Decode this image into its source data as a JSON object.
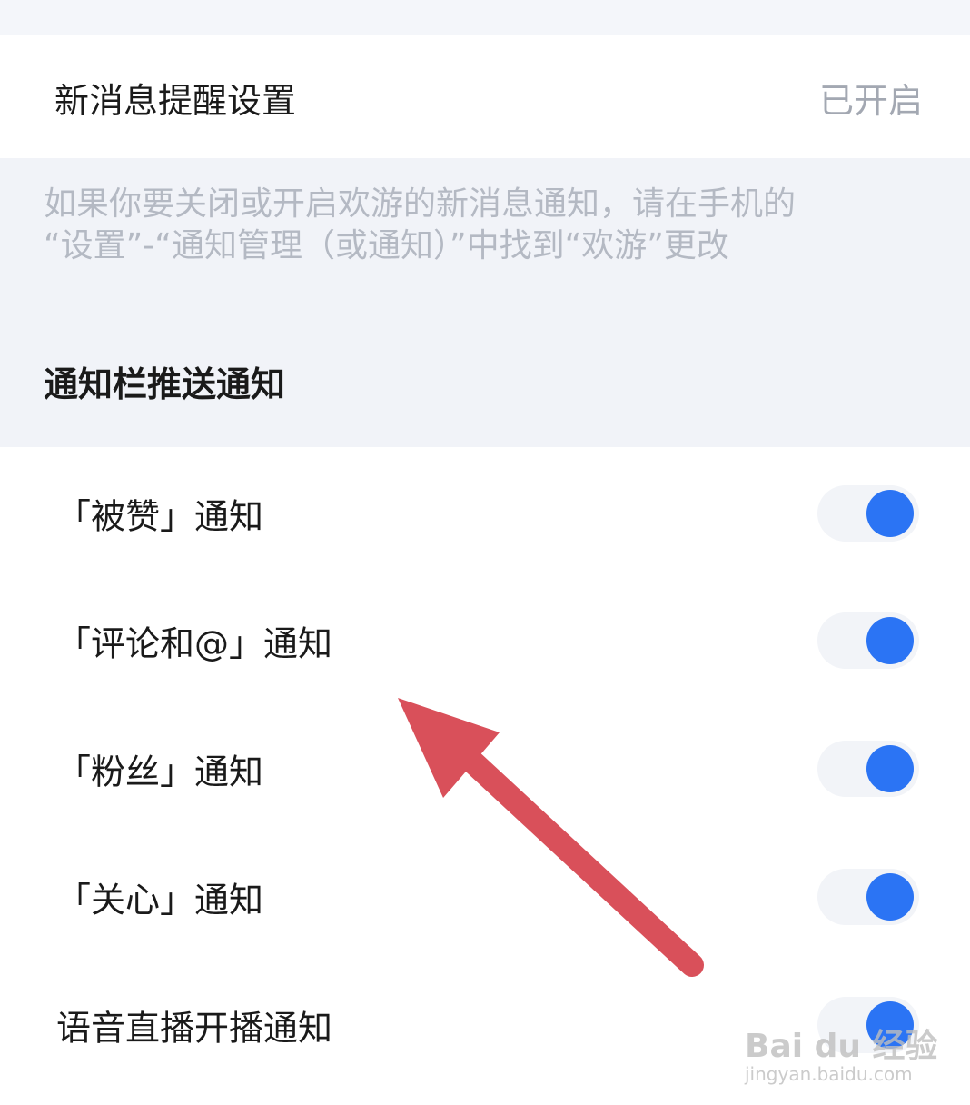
{
  "new_message": {
    "title": "新消息提醒设置",
    "status": "已开启"
  },
  "hint": {
    "line1": "如果你要关闭或开启欢游的新消息通知，请在手机的",
    "line2": "“设置”-“通知管理（或通知）”中找到“欢游”更改"
  },
  "section_title": "通知栏推送通知",
  "items": [
    {
      "label": "「被赞」通知",
      "enabled": true
    },
    {
      "label": "「评论和@」通知",
      "enabled": true
    },
    {
      "label": "「粉丝」通知",
      "enabled": true
    },
    {
      "label": "「关心」通知",
      "enabled": true
    },
    {
      "label": "语音直播开播通知",
      "enabled": true
    }
  ],
  "colors": {
    "toggle_on": "#2b74f4",
    "annotation_arrow": "#d9505a"
  },
  "icons": {
    "annotation": "arrow-icon"
  },
  "watermark": {
    "main": "Bai du 经验",
    "sub": "jingyan.baidu.com"
  }
}
